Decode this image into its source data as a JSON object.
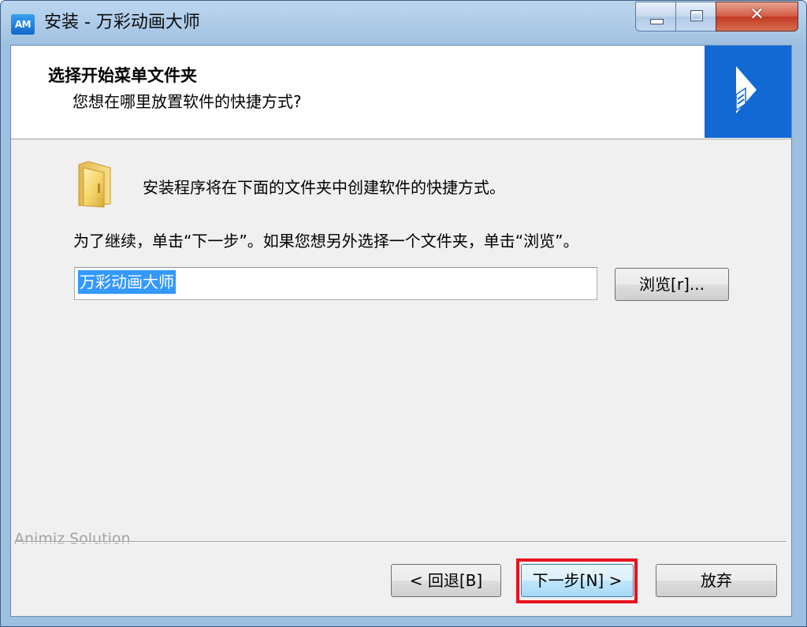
{
  "window": {
    "app_icon_label": "AM",
    "title": "安装 - 万彩动画大师",
    "close_glyph": "✕"
  },
  "header": {
    "title": "选择开始菜单文件夹",
    "subtitle": "您想在哪里放置软件的快捷方式?"
  },
  "body": {
    "message1": "安装程序将在下面的文件夹中创建软件的快捷方式。",
    "message2": "为了继续，单击“下一步”。如果您想另外选择一个文件夹，单击“浏览”。",
    "folder_value": "万彩动画大师",
    "browse_label": "浏览[r]..."
  },
  "footer": {
    "brand": "Animiz Solution",
    "back_label": "< 回退[B]",
    "next_label": "下一步[N] >",
    "cancel_label": "放弃"
  },
  "colors": {
    "brand_blue": "#1269d3",
    "highlight_red": "#e8121f",
    "selection_blue": "#3399ff"
  },
  "icons": {
    "app": "animiz-app-icon",
    "folder": "folder-icon",
    "brand": "animiz-logo-icon"
  }
}
